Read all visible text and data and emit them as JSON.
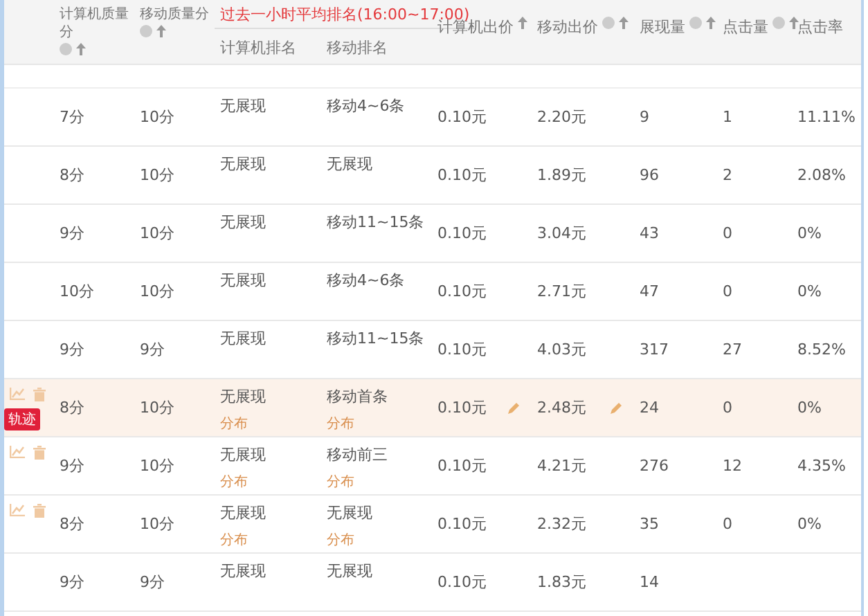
{
  "table": {
    "columns": [
      {
        "label": "计算机质量分",
        "help": true,
        "sort": true
      },
      {
        "label": "移动质量分",
        "help": true,
        "sort": true
      },
      {
        "group": "过去一小时平均排名(16:00~17:00)",
        "children": [
          "计算机排名",
          "移动排名"
        ]
      },
      {
        "label": "计算机出价",
        "help": false,
        "sort": true
      },
      {
        "label": "移动出价",
        "help": true,
        "sort": true
      },
      {
        "label": "展现量",
        "help": true,
        "sort": true
      },
      {
        "label": "点击量",
        "help": true,
        "sort": true
      },
      {
        "label": "点击率",
        "help": false,
        "sort": false
      }
    ],
    "rows": [
      {
        "selected": false,
        "tools": false,
        "editable": false,
        "pc_quality": "7分",
        "mobile_quality": "10分",
        "pc_rank": "无展现",
        "mobile_rank": "移动4~6条",
        "pc_bid": "0.10元",
        "mobile_bid": "2.20元",
        "impressions": "9",
        "clicks": "1",
        "ctr": "11.11%"
      },
      {
        "selected": false,
        "tools": false,
        "editable": false,
        "pc_quality": "8分",
        "mobile_quality": "10分",
        "pc_rank": "无展现",
        "mobile_rank": "无展现",
        "pc_bid": "0.10元",
        "mobile_bid": "1.89元",
        "impressions": "96",
        "clicks": "2",
        "ctr": "2.08%"
      },
      {
        "selected": false,
        "tools": false,
        "editable": false,
        "pc_quality": "9分",
        "mobile_quality": "10分",
        "pc_rank": "无展现",
        "mobile_rank": "移动11~15条",
        "pc_bid": "0.10元",
        "mobile_bid": "3.04元",
        "impressions": "43",
        "clicks": "0",
        "ctr": "0%"
      },
      {
        "selected": false,
        "tools": false,
        "editable": false,
        "pc_quality": "10分",
        "mobile_quality": "10分",
        "pc_rank": "无展现",
        "mobile_rank": "移动4~6条",
        "pc_bid": "0.10元",
        "mobile_bid": "2.71元",
        "impressions": "47",
        "clicks": "0",
        "ctr": "0%"
      },
      {
        "selected": false,
        "tools": false,
        "editable": false,
        "pc_quality": "9分",
        "mobile_quality": "9分",
        "pc_rank": "无展现",
        "mobile_rank": "移动11~15条",
        "pc_bid": "0.10元",
        "mobile_bid": "4.03元",
        "impressions": "317",
        "clicks": "27",
        "ctr": "8.52%"
      },
      {
        "selected": true,
        "tools": true,
        "badge": "轨迹",
        "editable": true,
        "pc_quality": "8分",
        "mobile_quality": "10分",
        "pc_rank": "无展现",
        "pc_rank_link": "分布",
        "mobile_rank": "移动首条",
        "mobile_rank_link": "分布",
        "pc_bid": "0.10元",
        "mobile_bid": "2.48元",
        "impressions": "24",
        "clicks": "0",
        "ctr": "0%"
      },
      {
        "selected": false,
        "tools": true,
        "editable": false,
        "pc_quality": "9分",
        "mobile_quality": "10分",
        "pc_rank": "无展现",
        "pc_rank_link": "分布",
        "mobile_rank": "移动前三",
        "mobile_rank_link": "分布",
        "pc_bid": "0.10元",
        "mobile_bid": "4.21元",
        "impressions": "276",
        "clicks": "12",
        "ctr": "4.35%"
      },
      {
        "selected": false,
        "tools": true,
        "editable": false,
        "pc_quality": "8分",
        "mobile_quality": "10分",
        "pc_rank": "无展现",
        "pc_rank_link": "分布",
        "mobile_rank": "无展现",
        "mobile_rank_link": "分布",
        "pc_bid": "0.10元",
        "mobile_bid": "2.32元",
        "impressions": "35",
        "clicks": "0",
        "ctr": "0%"
      },
      {
        "selected": false,
        "tools": false,
        "editable": false,
        "pc_quality": "9分",
        "mobile_quality": "9分",
        "pc_rank": "无展现",
        "mobile_rank": "无展现",
        "pc_bid": "0.10元",
        "mobile_bid": "1.83元",
        "impressions": "14"
      }
    ]
  }
}
